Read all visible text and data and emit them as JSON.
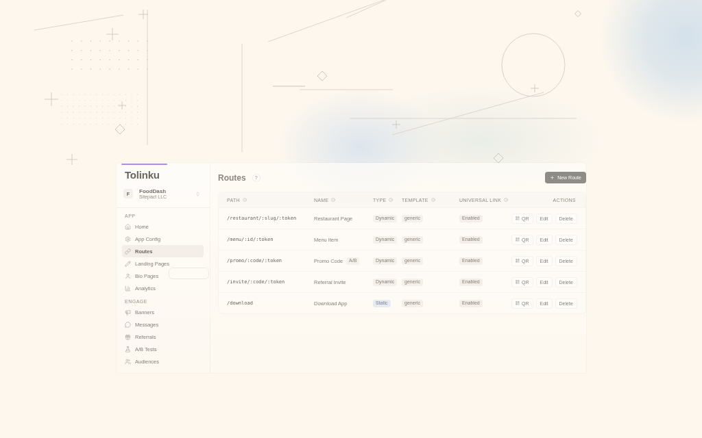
{
  "sidebar": {
    "logo": "Tolinku",
    "workspace": {
      "avatar": "F",
      "name": "FoodDash",
      "company": "Sitepact LLC"
    },
    "sections": [
      {
        "label": "APP",
        "items": [
          {
            "label": "Home",
            "selected": false
          },
          {
            "label": "App Config",
            "selected": false
          },
          {
            "label": "Routes",
            "selected": true
          },
          {
            "label": "Landing Pages",
            "selected": false
          },
          {
            "label": "Bio Pages",
            "selected": false
          },
          {
            "label": "Analytics",
            "selected": false
          }
        ]
      },
      {
        "label": "ENGAGE",
        "items": [
          {
            "label": "Banners",
            "selected": false
          },
          {
            "label": "Messages",
            "selected": false
          },
          {
            "label": "Referrals",
            "selected": false
          },
          {
            "label": "A/B Tests",
            "selected": false
          },
          {
            "label": "Audiences",
            "selected": false
          }
        ]
      }
    ]
  },
  "header": {
    "title": "Routes",
    "help": "?",
    "new_button": "New Route"
  },
  "table": {
    "columns": [
      {
        "label": "PATH",
        "info": true
      },
      {
        "label": "NAME",
        "info": true
      },
      {
        "label": "TYPE",
        "info": true
      },
      {
        "label": "TEMPLATE",
        "info": true
      },
      {
        "label": "UNIVERSAL LINK",
        "info": true
      },
      {
        "label": "ACTIONS",
        "info": false
      }
    ],
    "rows": [
      {
        "path": "/restaurant/:slug/:token",
        "name": "Restaurant Page",
        "type": {
          "label": "Dynamic",
          "kind": "dynamic"
        },
        "template": "generic",
        "universal_link": "Enabled",
        "actions": [
          {
            "label": "QR",
            "kind": "qr"
          },
          {
            "label": "Edit",
            "kind": "edit"
          },
          {
            "label": "Delete",
            "kind": "delete"
          }
        ]
      },
      {
        "path": "/menu/:id/:token",
        "name": "Menu Item",
        "type": {
          "label": "Dynamic",
          "kind": "dynamic"
        },
        "template": "generic",
        "universal_link": "Enabled",
        "actions": [
          {
            "label": "QR",
            "kind": "qr"
          },
          {
            "label": "Edit",
            "kind": "edit"
          },
          {
            "label": "Delete",
            "kind": "delete"
          }
        ]
      },
      {
        "path": "/promo/:code/:token",
        "name": "Promo Code",
        "badge": "A/B",
        "type": {
          "label": "Dynamic",
          "kind": "dynamic"
        },
        "template": "generic",
        "universal_link": "Enabled",
        "actions": [
          {
            "label": "QR",
            "kind": "qr"
          },
          {
            "label": "Edit",
            "kind": "edit"
          },
          {
            "label": "Delete",
            "kind": "delete"
          }
        ]
      },
      {
        "path": "/invite/:code/:token",
        "name": "Referral Invite",
        "type": {
          "label": "Dynamic",
          "kind": "dynamic"
        },
        "template": "generic",
        "universal_link": "Enabled",
        "actions": [
          {
            "label": "QR",
            "kind": "qr"
          },
          {
            "label": "Edit",
            "kind": "edit"
          },
          {
            "label": "Delete",
            "kind": "delete"
          }
        ]
      },
      {
        "path": "/download",
        "name": "Download App",
        "type": {
          "label": "Static",
          "kind": "static"
        },
        "template": "generic",
        "universal_link": "Enabled",
        "actions": [
          {
            "label": "QR",
            "kind": "qr"
          },
          {
            "label": "Edit",
            "kind": "edit"
          },
          {
            "label": "Delete",
            "kind": "delete"
          }
        ]
      }
    ]
  }
}
